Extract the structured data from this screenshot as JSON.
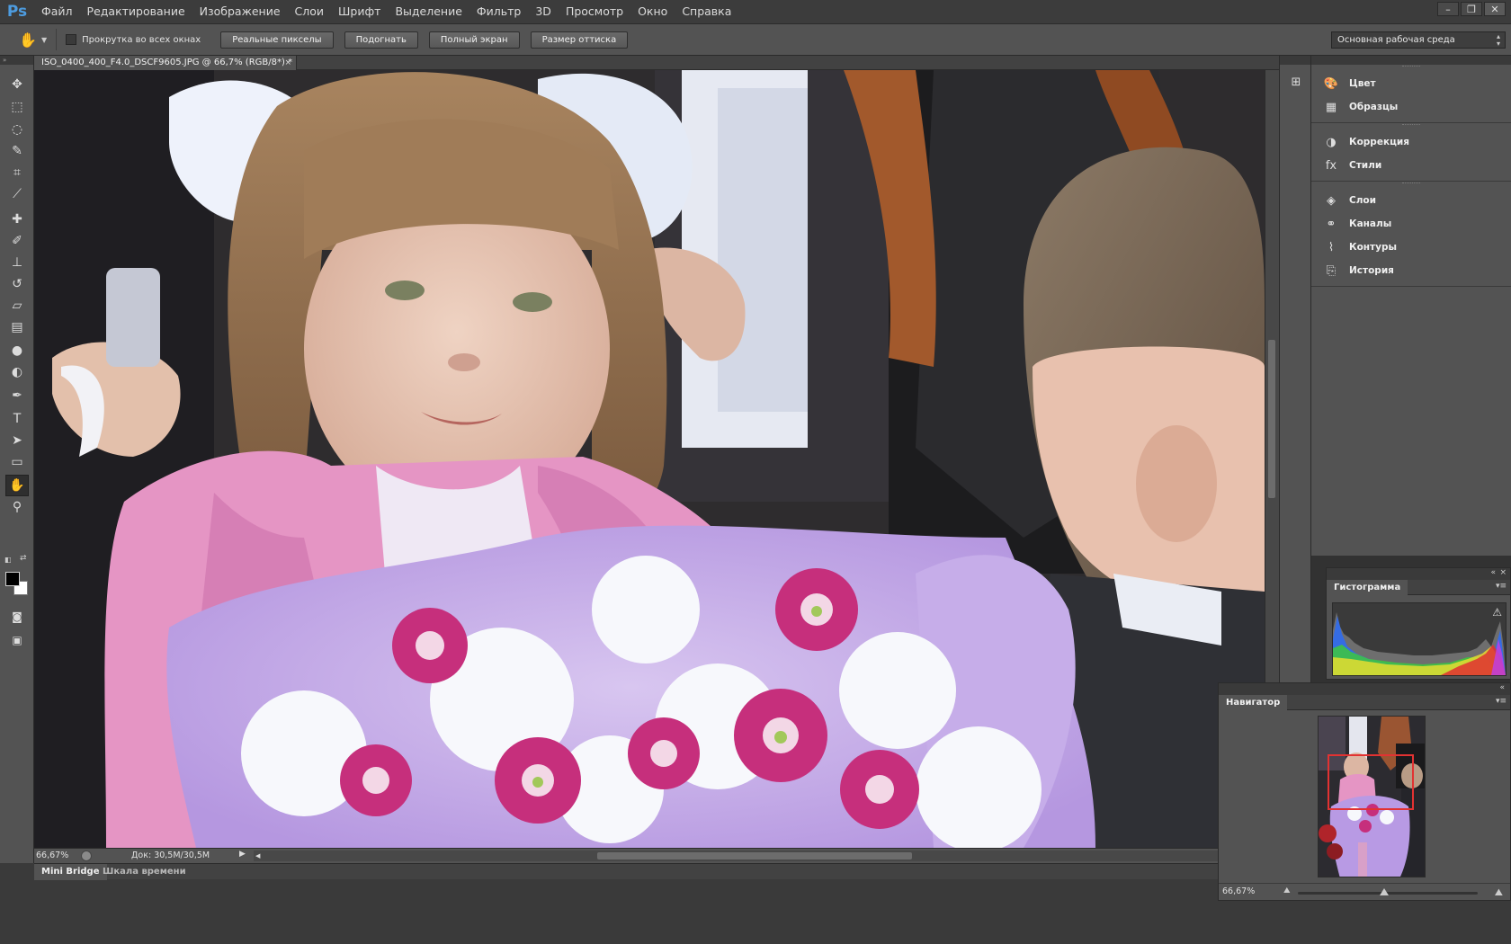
{
  "app": {
    "logo": "Ps",
    "menu": [
      "Файл",
      "Редактирование",
      "Изображение",
      "Слои",
      "Шрифт",
      "Выделение",
      "Фильтр",
      "3D",
      "Просмотр",
      "Окно",
      "Справка"
    ],
    "window_controls": [
      "–",
      "❐",
      "✕"
    ]
  },
  "options_bar": {
    "tool_icon": "hand-icon",
    "scroll_all_label": "Прокрутка во всех окнах",
    "scroll_all_checked": false,
    "buttons": [
      "Реальные пикселы",
      "Подогнать",
      "Полный экран",
      "Размер оттиска"
    ],
    "workspace": "Основная рабочая среда"
  },
  "tools": [
    {
      "name": "move-tool",
      "icon": "✥"
    },
    {
      "name": "marquee-tool",
      "icon": "⬚"
    },
    {
      "name": "lasso-tool",
      "icon": "◌"
    },
    {
      "name": "quick-select-tool",
      "icon": "✎"
    },
    {
      "name": "crop-tool",
      "icon": "⌗"
    },
    {
      "name": "eyedropper-tool",
      "icon": "⟋"
    },
    {
      "name": "healing-brush-tool",
      "icon": "✚"
    },
    {
      "name": "brush-tool",
      "icon": "✐"
    },
    {
      "name": "clone-stamp-tool",
      "icon": "⊥"
    },
    {
      "name": "history-brush-tool",
      "icon": "↺"
    },
    {
      "name": "eraser-tool",
      "icon": "▱"
    },
    {
      "name": "gradient-tool",
      "icon": "▤"
    },
    {
      "name": "blur-tool",
      "icon": "●"
    },
    {
      "name": "dodge-tool",
      "icon": "◐"
    },
    {
      "name": "pen-tool",
      "icon": "✒"
    },
    {
      "name": "type-tool",
      "icon": "T"
    },
    {
      "name": "path-selection-tool",
      "icon": "➤"
    },
    {
      "name": "rectangle-tool",
      "icon": "▭"
    },
    {
      "name": "hand-tool",
      "icon": "✋",
      "active": true
    },
    {
      "name": "zoom-tool",
      "icon": "⚲"
    }
  ],
  "document": {
    "tab_title": "ISO_0400_400_F4.0_DSCF9605.JPG @ 66,7% (RGB/8*) *",
    "close": "×"
  },
  "status": {
    "zoom": "66,67%",
    "doc_info": "Док: 30,5M/30,5M"
  },
  "bottom_tabs": [
    "Mini Bridge",
    "Шкала времени"
  ],
  "dock": {
    "groups": [
      [
        {
          "label": "Цвет",
          "icon": "palette-icon"
        },
        {
          "label": "Образцы",
          "icon": "swatches-icon"
        }
      ],
      [
        {
          "label": "Коррекция",
          "icon": "adjustments-icon"
        },
        {
          "label": "Стили",
          "icon": "styles-icon"
        }
      ],
      [
        {
          "label": "Слои",
          "icon": "layers-icon"
        },
        {
          "label": "Каналы",
          "icon": "channels-icon"
        },
        {
          "label": "Контуры",
          "icon": "paths-icon"
        },
        {
          "label": "История",
          "icon": "history-icon"
        }
      ]
    ]
  },
  "histogram": {
    "title": "Гистограмма",
    "warning_icon": "warning-icon"
  },
  "navigator": {
    "title": "Навигатор",
    "zoom": "66,67%",
    "zoom_level": 0.5
  },
  "colors": {
    "foreground": "#000000",
    "background": "#ffffff",
    "view_box": "#e23232"
  }
}
